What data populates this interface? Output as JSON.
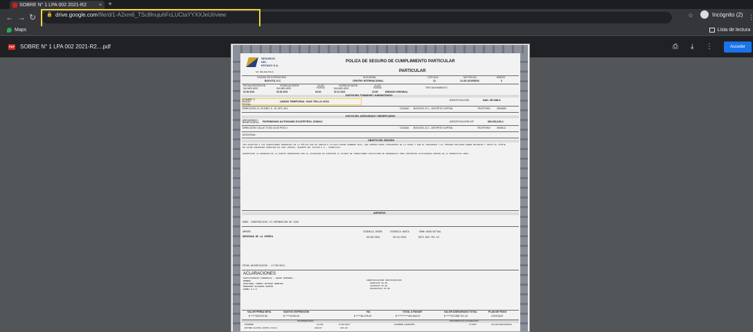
{
  "browser": {
    "tab_title": "SOBRE N° 1 LPA 002 2021-R2",
    "tab_close": "×",
    "new_tab": "+",
    "url_host": "drive.google.com",
    "url_path": "/file/d/1-A2xm6_TSc8lnujuhFcLUCtaYYXXJeUI/view",
    "profile_label": "Incógnito (2)",
    "bookmark_maps": "Maps",
    "bookmark_reading": "Lista de lectura"
  },
  "pdf_viewer": {
    "file_title": "SOBRE N° 1 LPA 002 2021-R2....pdf",
    "file_badge": "PDF",
    "acceder_label": "Acceder"
  },
  "document": {
    "brand_line1": "SEGUROS",
    "brand_line2": "DEL",
    "brand_line3": "ESTADO S.A.",
    "brand_nit": "NIT. 860.009.578-6",
    "title": "POLIZA DE SEGURO DE CUMPLIMIENTO PARTICULAR",
    "subtitle": "PARTICULAR",
    "ciudad_label": "CIUDAD DE EXPEDICIÓN",
    "ciudad_value": "BOGOTA, D.C.",
    "sucursal_label": "SUCURSAL",
    "sucursal_value": "CENTRO INTERNACIONAL",
    "codsuc_label": "COD.SUC",
    "codsuc_value": "12",
    "nopoliza_label": "NO.PÓLIZA",
    "nopoliza_value": "12-45-101008203",
    "anexo_label": "ANEXO",
    "anexo_value": "0",
    "fecha_exp_label": "FECHA EXPEDICIÓN",
    "fecha_exp_cols": "DIA  MES  AÑO",
    "fecha_exp_value": "02   09   2021",
    "vig_desde_label": "VIGENCIA DESDE",
    "vig_desde_cols": "DIA  MES  AÑO",
    "vig_desde_value": "03   09   2021",
    "alas1_label": "A LAS HORAS",
    "alas1_value": "00:00",
    "vig_hasta_label": "VIGENCIA HASTA",
    "vig_hasta_cols": "DIA  MES  AÑO",
    "vig_hasta_value": "30   12   2021",
    "alas2_label": "A LAS HORAS",
    "alas2_value": "23:59",
    "tipo_mov_label": "TIPO MOVIMIENTO",
    "tipo_mov_value": "EMISION ORIGINAL",
    "tomador_header": "DATOS DEL TOMADOR / GARANTIZADO",
    "nombre_label": "NOMBRE O RAZON SOCIAL:",
    "nombre_value": "UNION TEMPORAL VIAS TELLO 2021",
    "identificacion_label": "IDENTIFICACIÓN",
    "identificacion_value": "NAD: 287.668-8",
    "direccion_label": "DIRECCIÓN",
    "direccion_value": "CL 19 NRO. 5 - 51 OFC 404",
    "ciudad2_label": "CIUDAD",
    "ciudad2_value": "BOGOTA, D.C., DISTRITO CAPITAL",
    "telefono_label": "TELÉFONO",
    "telefono_value": "3504825",
    "asegurado_header": "DATOS DEL ASEGURADO / BENEFICIARIO",
    "asegurado_label": "ASEGURADO / BENEFICIARIO:",
    "asegurado_value": "PATRIMONIO AUTONOMO ECOPETROL ZOMAC",
    "ident2_label": "IDENTIFICACIÓN NIT:",
    "ident2_value": "830.053.105-3",
    "direccion2_label": "DIRECCIÓN",
    "direccion2_value": "CALLE 72 NO.10-03 PISO 1",
    "ciudad3_label": "CIUDAD",
    "ciudad3_value": "BOGOTA, D.C., DISTRITO CAPITAL",
    "telefono2_label": "TELÉFONO",
    "telefono2_value": "3545111",
    "adicional_label": "ADICIONAL:",
    "objeto_header": "OBJETO DEL SEGURO",
    "objeto_text": "CON SUJECIÓN A LAS CONDICIONES GENERALES DE LA PÓLIZA QUE SE ANEXAN E-CU-001A DESDE FEBRERO 2011, QUE FORMAN PARTE INTEGRANTE DE LA MISMA Y QUE EL ASEGURADO Y EL TOMADOR DECLARAN HABER RECIBIDO Y HASTA EL LÍMITE DE VALOR ASEGURADO SEÑALADO EN CADA AMPARO, SEGUROS DEL ESTADO S.A., GARANTIZA:",
    "objeto_text2": "GARANTIZAR LA SERIEDAD DE LA OFERTA PRESENTADA POR EL AFIANZADO EN ATENCIÓN AL PLIEGO DE CONDICIONES INVITACIÓN DE REFERENCIA PARA CONTRATAR ACTIVIDADES DENTRO DE LA RESPECTIVA ZONA.",
    "amparos_header": "AMPAROS",
    "ramo_text": "RAMO: CONSTRUCCION Y/O REPARACION DE VIAS",
    "amparo_col": "AMPARO",
    "vig_desde_col": "VIGENCIA DESDE",
    "vig_hasta_col": "VIGENCIA HASTA",
    "suma_col": "SUMA ASEG/ACTUAL",
    "amparo_row": "SERIEDAD DE LA OFERTA",
    "amparo_desde": "03/09/2021",
    "amparo_hasta": "30/12/2021",
    "amparo_suma": "$372.855.701.10",
    "fecha_adj": "FECHA ADJUDICACION : 17/09/2021",
    "aclaraciones_header": "ACLARACIONES",
    "aclaraciones_l1": "PARTICIPANTES CONSORCIO - UNION TEMPORAL :",
    "aclaraciones_l2": "NOMBRE",
    "aclaraciones_l3": "ARISTOBAL CORREA ANTONIO RODRIGO",
    "aclaraciones_l4": "ROBINSON SALGUERA SENIOR",
    "aclaraciones_l5": "HUMBA S.A.S",
    "aclaraciones_c2": "IDENTIFICACION   PARTICIPACION",
    "aclaraciones_c2b": "88001146           50.00",
    "aclaraciones_c2c": "12238103           25.00",
    "aclaraciones_c2d": "9013015145         25.00",
    "valor_prima_label": "VALOR PRIMA NETA",
    "valor_prima_value": "$ *****330.573.50",
    "gastos_label": "GASTOS EXPEDICIÓN",
    "gastos_value": "$ *****8.000,00",
    "iva_label": "IVA",
    "iva_value": "$ *****80.278.00",
    "total_label": "TOTAL A PAGAR",
    "total_value": "$ ***********490.846.00",
    "valor_aseg_label": "VALOR ASEGURADO TOTAL",
    "valor_aseg_value": "$ *****372.855.701.10",
    "plan_pago_label": "PLAN DE PAGO",
    "plan_pago_value": "CONTADO",
    "intermediario_header": "INTERMEDIARIO",
    "distribucion_header": "DISTRIBUCION COASEGURO",
    "inter_nombre_col": "NOMBRE",
    "inter_clave_col": "CLAVE",
    "inter_part_col": "% DE PART.",
    "coa_nombre_col": "NOMBRE COMPAÑÍA",
    "coa_part_col": "% PART",
    "coa_valor_col": "VALOR ASEGURADO",
    "inter_row_nombre": "ESTIBB ALEYDA ACOSTA AVILA",
    "inter_row_clave": "491447",
    "inter_row_part": "100.00"
  }
}
